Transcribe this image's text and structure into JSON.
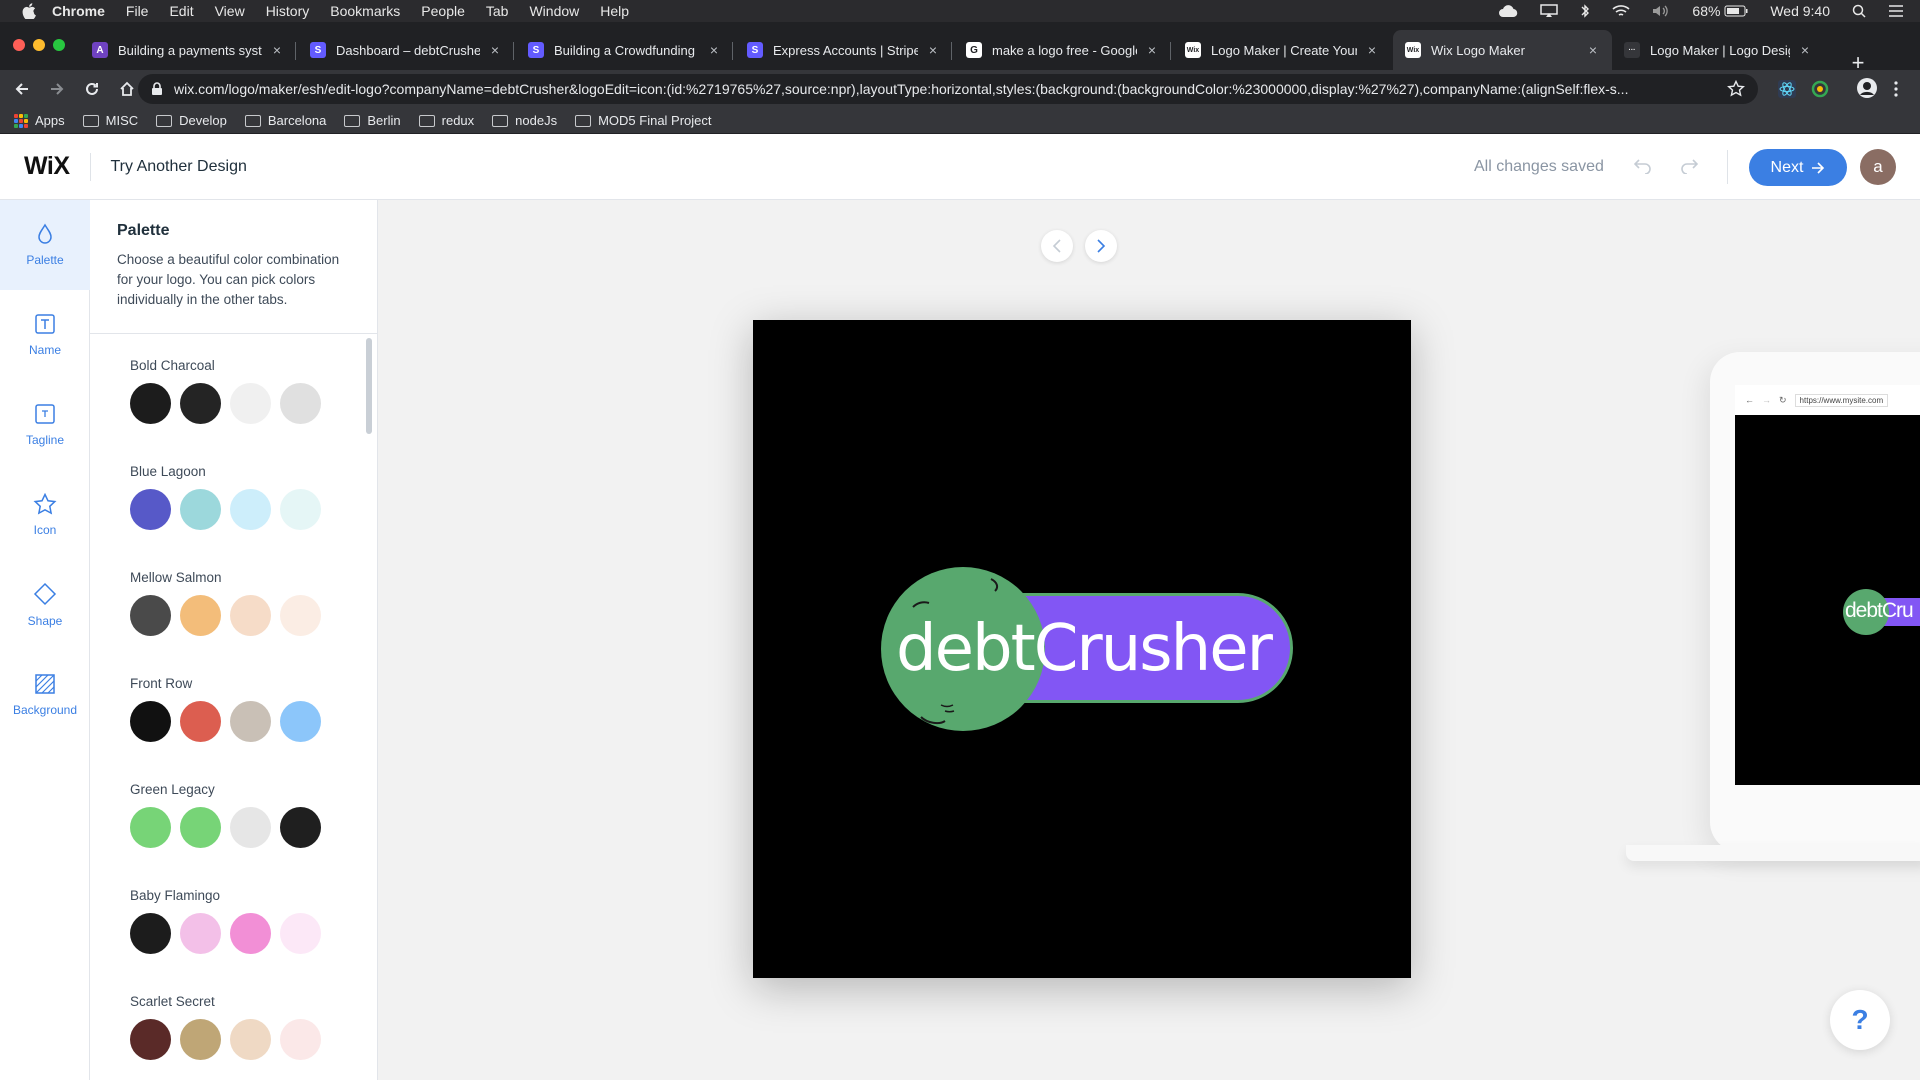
{
  "mac_menubar": {
    "app_name": "Chrome",
    "items": [
      "File",
      "Edit",
      "View",
      "History",
      "Bookmarks",
      "People",
      "Tab",
      "Window",
      "Help"
    ],
    "battery": "68%",
    "clock": "Wed 9:40"
  },
  "tabs": [
    {
      "title": "Building a payments system",
      "favicon": "A",
      "color": "#6f42c1"
    },
    {
      "title": "Dashboard – debtCrusher –",
      "favicon": "S",
      "color": "#635bff"
    },
    {
      "title": "Building a Crowdfunding Pl",
      "favicon": "S",
      "color": "#635bff"
    },
    {
      "title": "Express Accounts | Stripe C",
      "favicon": "S",
      "color": "#635bff"
    },
    {
      "title": "make a logo free - Google S",
      "favicon": "G",
      "color": "#ffffff"
    },
    {
      "title": "Logo Maker | Create Your C",
      "favicon": "Wix",
      "color": "#ffffff"
    },
    {
      "title": "Wix Logo Maker",
      "favicon": "Wix",
      "color": "#ffffff"
    },
    {
      "title": "Logo Maker | Logo Design F",
      "favicon": "···",
      "color": "#35363a"
    }
  ],
  "address_bar": {
    "url": "wix.com/logo/maker/esh/edit-logo?companyName=debtCrusher&logoEdit=icon:(id:%2719765%27,source:npr),layoutType:horizontal,styles:(background:(backgroundColor:%23000000,display:%27%27),companyName:(alignSelf:flex-s..."
  },
  "bookmarks": [
    "Apps",
    "MISC",
    "Develop",
    "Barcelona",
    "Berlin",
    "redux",
    "nodeJs",
    "MOD5 Final Project"
  ],
  "header": {
    "logo": "WiX",
    "title": "Try Another Design",
    "status": "All changes saved",
    "next_label": "Next",
    "avatar_initial": "a"
  },
  "rail": [
    {
      "label": "Palette",
      "icon": "drop-icon"
    },
    {
      "label": "Name",
      "icon": "text-box-icon"
    },
    {
      "label": "Tagline",
      "icon": "text-box-small-icon"
    },
    {
      "label": "Icon",
      "icon": "star-icon"
    },
    {
      "label": "Shape",
      "icon": "diamond-icon"
    },
    {
      "label": "Background",
      "icon": "hatched-square-icon"
    }
  ],
  "panel": {
    "title": "Palette",
    "description": "Choose a beautiful color combination for your logo. You can pick colors individually in the other tabs.",
    "palettes": [
      {
        "name": "Bold Charcoal",
        "colors": [
          "#1c1c1c",
          "#242424",
          "#f0f0f0",
          "#e0e0e0"
        ]
      },
      {
        "name": "Blue Lagoon",
        "colors": [
          "#5759c8",
          "#9cd8dc",
          "#cdeefb",
          "#e5f6f6"
        ]
      },
      {
        "name": "Mellow Salmon",
        "colors": [
          "#4a4a4a",
          "#f3bd7a",
          "#f6dcc8",
          "#fbede4"
        ]
      },
      {
        "name": "Front Row",
        "colors": [
          "#111111",
          "#dc5e50",
          "#c9c0b6",
          "#8cc6fa"
        ]
      },
      {
        "name": "Green Legacy",
        "colors": [
          "#77d477",
          "#77d477",
          "#e6e6e6",
          "#1f1f1f"
        ]
      },
      {
        "name": "Baby Flamingo",
        "colors": [
          "#1c1c1c",
          "#f3c0e8",
          "#f28fd6",
          "#fce8f7"
        ]
      },
      {
        "name": "Scarlet Secret",
        "colors": [
          "#5a2a28",
          "#bfa676",
          "#efd9c4",
          "#fbe8e8"
        ]
      }
    ]
  },
  "logo_preview": {
    "company_name": "debtCrusher",
    "background": "#000000",
    "pill_color": "#8256f4",
    "circle_color": "#58a86e"
  },
  "mockup": {
    "url": "https://www.mysite.com",
    "logo_text": "debtCru"
  },
  "help": {
    "label": "?"
  }
}
